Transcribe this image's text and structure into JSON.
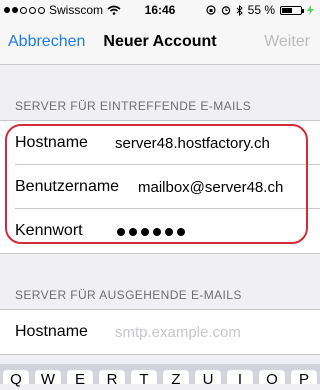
{
  "status_bar": {
    "signal_dots": [
      true,
      true,
      false,
      false,
      false
    ],
    "carrier": "Swisscom",
    "wifi_icon": "wifi-icon",
    "time": "16:46",
    "lock_icon": "rotation-lock-icon",
    "alarm_icon": "alarm-icon",
    "bluetooth_icon": "bluetooth-icon",
    "battery_level": "55 %",
    "battery_fraction": 0.55,
    "charging_icon": "charging-icon"
  },
  "nav": {
    "cancel_label": "Abbrechen",
    "title": "Neuer Account",
    "next_label": "Weiter"
  },
  "incoming": {
    "header": "SERVER FÜR EINTREFFENDE E-MAILS",
    "hostname_label": "Hostname",
    "hostname_value": "server48.hostfactory.ch",
    "username_label": "Benutzername",
    "username_value": "mailbox@server48.ch",
    "password_label": "Kennwort",
    "password_length": 6
  },
  "outgoing": {
    "header": "SERVER FÜR AUSGEHENDE E-MAILS",
    "hostname_label": "Hostname",
    "hostname_placeholder": "smtp.example.com"
  },
  "keyboard": {
    "keys": [
      "Q",
      "W",
      "E",
      "R",
      "T",
      "Z",
      "U",
      "I",
      "O",
      "P"
    ]
  },
  "colors": {
    "accent": "#1e7ce6",
    "highlight": "#d42b39",
    "background": "#efeff4"
  }
}
